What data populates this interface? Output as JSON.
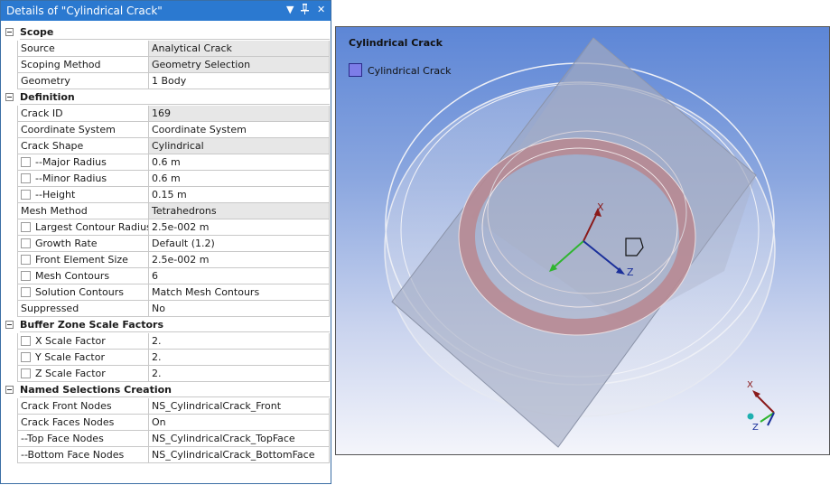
{
  "details": {
    "title": "Details of \"Cylindrical Crack\"",
    "controls": {
      "dropdown_icon": "chevron-down-icon",
      "pin_icon": "pin-icon",
      "close_icon": "close-icon"
    },
    "sections": [
      {
        "label": "Scope",
        "rows": [
          {
            "key": "Source",
            "value": "Analytical Crack",
            "checkbox": false,
            "shaded": true
          },
          {
            "key": "Scoping Method",
            "value": "Geometry Selection",
            "checkbox": false,
            "shaded": true
          },
          {
            "key": "Geometry",
            "value": "1 Body",
            "checkbox": false,
            "shaded": false
          }
        ]
      },
      {
        "label": "Definition",
        "rows": [
          {
            "key": "Crack ID",
            "value": "169",
            "checkbox": false,
            "shaded": true
          },
          {
            "key": "Coordinate System",
            "value": "Coordinate System",
            "checkbox": false,
            "shaded": false
          },
          {
            "key": "Crack Shape",
            "value": "Cylindrical",
            "checkbox": false,
            "shaded": true
          },
          {
            "key": "--Major Radius",
            "value": "0.6 m",
            "checkbox": true,
            "shaded": false
          },
          {
            "key": "--Minor Radius",
            "value": "0.6 m",
            "checkbox": true,
            "shaded": false
          },
          {
            "key": "--Height",
            "value": "0.15 m",
            "checkbox": true,
            "shaded": false
          },
          {
            "key": "Mesh Method",
            "value": "Tetrahedrons",
            "checkbox": false,
            "shaded": true
          },
          {
            "key": "Largest Contour Radius",
            "value": "2.5e-002 m",
            "checkbox": true,
            "shaded": false
          },
          {
            "key": "Growth Rate",
            "value": "Default (1.2)",
            "checkbox": true,
            "shaded": false
          },
          {
            "key": "Front Element Size",
            "value": "2.5e-002 m",
            "checkbox": true,
            "shaded": false
          },
          {
            "key": "Mesh Contours",
            "value": "6",
            "checkbox": true,
            "shaded": false
          },
          {
            "key": "Solution Contours",
            "value": "Match Mesh Contours",
            "checkbox": true,
            "shaded": false
          },
          {
            "key": "Suppressed",
            "value": "No",
            "checkbox": false,
            "shaded": false
          }
        ]
      },
      {
        "label": "Buffer Zone Scale Factors",
        "rows": [
          {
            "key": "X Scale Factor",
            "value": "2.",
            "checkbox": true,
            "shaded": false
          },
          {
            "key": "Y Scale Factor",
            "value": "2.",
            "checkbox": true,
            "shaded": false
          },
          {
            "key": "Z Scale Factor",
            "value": "2.",
            "checkbox": true,
            "shaded": false
          }
        ]
      },
      {
        "label": "Named Selections Creation",
        "rows": [
          {
            "key": "Crack Front Nodes",
            "value": "NS_CylindricalCrack_Front",
            "checkbox": false,
            "shaded": false
          },
          {
            "key": "Crack Faces Nodes",
            "value": "On",
            "checkbox": false,
            "shaded": false
          },
          {
            "key": "--Top Face Nodes",
            "value": "NS_CylindricalCrack_TopFace",
            "checkbox": false,
            "shaded": false
          },
          {
            "key": "--Bottom Face Nodes",
            "value": "NS_CylindricalCrack_BottomFace",
            "checkbox": false,
            "shaded": false
          }
        ]
      }
    ]
  },
  "viewport": {
    "title": "Cylindrical Crack",
    "legend_label": "Cylindrical Crack",
    "legend_color": "#7d7de8",
    "axes": {
      "x": "X",
      "z": "Z"
    },
    "triad": {
      "x": "X",
      "z": "Z"
    }
  }
}
